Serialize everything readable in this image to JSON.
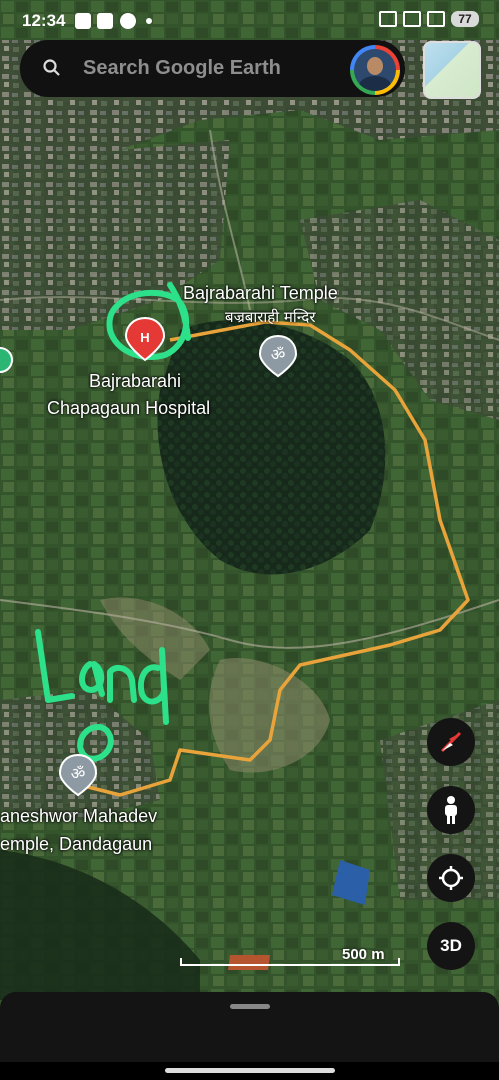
{
  "status_bar": {
    "time": "12:34",
    "battery": "77"
  },
  "search": {
    "placeholder": "Search Google Earth",
    "icon": "search-icon"
  },
  "profile": {
    "icon": "avatar"
  },
  "map": {
    "imagery": "satellite",
    "places": [
      {
        "name": "Bajrabarahi Temple",
        "alt_name": "बज्रबाराही मन्दिर",
        "icon": "om-icon"
      },
      {
        "name": "Bajrabarahi Chapagaun Hospital",
        "line1": "Bajrabarahi",
        "line2": "Chapagaun Hospital",
        "icon": "hospital-icon"
      },
      {
        "line1": "aneshwor Mahadev",
        "line2": "emple, Dandagaun",
        "icon": "om-icon"
      }
    ],
    "annotation": {
      "text": "Land",
      "color": "#2de08a"
    },
    "boundary_color": "#e8a33a",
    "scale": "500 m"
  },
  "controls": {
    "three_d": "3D",
    "compass": "compass-icon",
    "street_view": "person-icon",
    "locate": "locate-icon"
  },
  "colors": {
    "hospital": "#e53935",
    "temple_pin": "#8e9aa3",
    "boundary": "#e8a33a",
    "annotation": "#2de08a"
  }
}
